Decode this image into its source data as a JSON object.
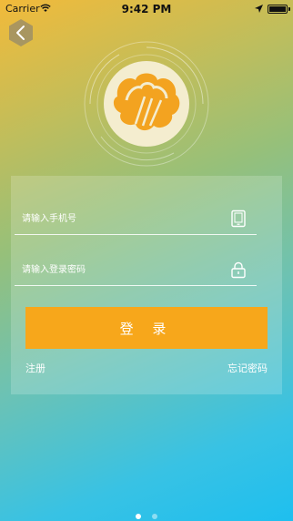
{
  "status_bar": {
    "carrier": "Carrier",
    "time": "9:42 PM"
  },
  "back_button": {
    "icon": "chevron-left-icon"
  },
  "logo": {
    "icon": "shell-logo-icon",
    "colors": {
      "circle": "#f4edcf",
      "shell": "#f3a320"
    }
  },
  "login_form": {
    "phone_placeholder": "请输入手机号",
    "phone_value": "",
    "phone_icon": "tablet-icon",
    "password_placeholder": "请输入登录密码",
    "password_value": "",
    "password_icon": "lock-icon",
    "login_label": "登 录",
    "register_label": "注册",
    "forgot_label": "忘记密码"
  },
  "pager": {
    "total": 2,
    "active": 1
  },
  "colors": {
    "accent": "#f7a71b",
    "gradient_top": "#f2ba3a",
    "gradient_bottom": "#1ebfef"
  }
}
